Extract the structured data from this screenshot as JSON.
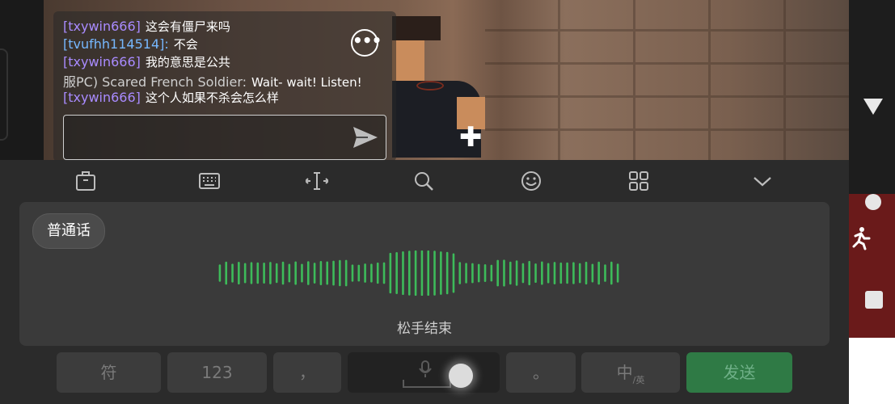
{
  "chat": {
    "messages": [
      {
        "name": "[txywin666]",
        "text": "这会有僵尸来吗",
        "name_color": "#a98bff"
      },
      {
        "name": "[tvufhh114514]:",
        "text": "不会",
        "name_color": "#76b8ff"
      },
      {
        "name": "[txywin666]",
        "text": "我的意思是公共",
        "name_color": "#a98bff"
      },
      {
        "name": "服PC) Scared French Soldier:",
        "text": "Wait- wait! Listen!",
        "name_color": "#cfcfcf"
      },
      {
        "name": "[txywin666]",
        "text": "这个人如果不杀会怎么样",
        "name_color": "#a98bff"
      }
    ],
    "input_value": "",
    "more_icon": "more-horizontal-icon",
    "send_icon": "send-icon"
  },
  "keyboard": {
    "toolbar_icons": [
      "clipboard-icon",
      "keyboard-icon",
      "cursor-move-icon",
      "search-icon",
      "emoji-icon",
      "grid-icon",
      "collapse-chevron-icon"
    ],
    "voice": {
      "language_button": "普通话",
      "hint": "松手结束",
      "wave_color": "#3dbb5a"
    },
    "keys": {
      "symbols": "符",
      "numbers": "123",
      "comma": "，",
      "period": "。",
      "lang_switch_main": "中",
      "lang_switch_sub": "/英",
      "send": "发送"
    }
  },
  "game": {
    "side_controls": [
      "triangle-icon",
      "circle-icon",
      "square-icon",
      "sprint-icon"
    ]
  }
}
